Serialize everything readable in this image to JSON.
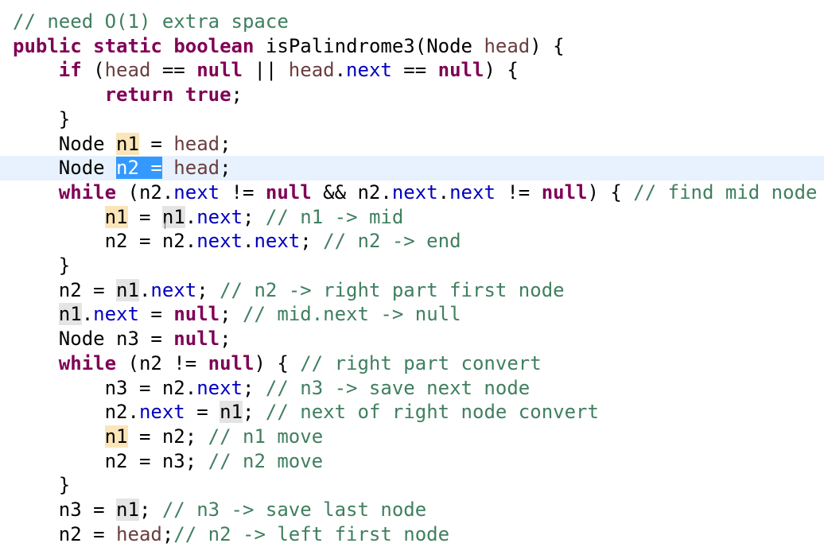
{
  "editor": {
    "language": "java",
    "colors": {
      "background": "#ffffff",
      "keyword": "#7f0055",
      "comment": "#3f7f5f",
      "field": "#0000c0",
      "parameter": "#6a3e3e",
      "current_line": "#e8f2fe",
      "occurrence_write": "#fbe5b8",
      "occurrence_read": "#e4e4e4",
      "selection": "#3399ff"
    },
    "lines": [
      {
        "tokens": [
          {
            "t": "// need O(1) extra space",
            "c": "comment"
          }
        ]
      },
      {
        "tokens": [
          {
            "t": "public",
            "c": "kw"
          },
          {
            "t": " "
          },
          {
            "t": "static",
            "c": "kw"
          },
          {
            "t": " "
          },
          {
            "t": "boolean",
            "c": "kw"
          },
          {
            "t": " isPalindrome3(Node "
          },
          {
            "t": "head",
            "c": "param"
          },
          {
            "t": ") {"
          }
        ]
      },
      {
        "tokens": [
          {
            "t": "    "
          },
          {
            "t": "if",
            "c": "kw"
          },
          {
            "t": " ("
          },
          {
            "t": "head",
            "c": "param"
          },
          {
            "t": " == "
          },
          {
            "t": "null",
            "c": "kw"
          },
          {
            "t": " || "
          },
          {
            "t": "head",
            "c": "param"
          },
          {
            "t": "."
          },
          {
            "t": "next",
            "c": "field"
          },
          {
            "t": " == "
          },
          {
            "t": "null",
            "c": "kw"
          },
          {
            "t": ") {"
          }
        ]
      },
      {
        "tokens": [
          {
            "t": "        "
          },
          {
            "t": "return",
            "c": "kw"
          },
          {
            "t": " "
          },
          {
            "t": "true",
            "c": "kw"
          },
          {
            "t": ";"
          }
        ]
      },
      {
        "tokens": [
          {
            "t": "    }"
          }
        ]
      },
      {
        "tokens": [
          {
            "t": "    Node "
          },
          {
            "t": "n1",
            "c": "hl-occ"
          },
          {
            "t": " = "
          },
          {
            "t": "head",
            "c": "param"
          },
          {
            "t": ";"
          }
        ]
      },
      {
        "current": true,
        "tokens": [
          {
            "t": "    Node "
          },
          {
            "t": "n2 =",
            "c": "hl-sel"
          },
          {
            "t": " "
          },
          {
            "t": "head",
            "c": "param"
          },
          {
            "t": ";"
          }
        ]
      },
      {
        "tokens": [
          {
            "t": "    "
          },
          {
            "t": "while",
            "c": "kw"
          },
          {
            "t": " (n2."
          },
          {
            "t": "next",
            "c": "field"
          },
          {
            "t": " != "
          },
          {
            "t": "null",
            "c": "kw"
          },
          {
            "t": " && n2."
          },
          {
            "t": "next",
            "c": "field"
          },
          {
            "t": "."
          },
          {
            "t": "next",
            "c": "field"
          },
          {
            "t": " != "
          },
          {
            "t": "null",
            "c": "kw"
          },
          {
            "t": ") { "
          },
          {
            "t": "// find mid node",
            "c": "comment"
          }
        ]
      },
      {
        "tokens": [
          {
            "t": "        "
          },
          {
            "t": "n1",
            "c": "hl-occ"
          },
          {
            "t": " = "
          },
          {
            "t": "n1",
            "c": "hl-read"
          },
          {
            "t": "."
          },
          {
            "t": "next",
            "c": "field"
          },
          {
            "t": "; "
          },
          {
            "t": "// n1 -> mid",
            "c": "comment"
          }
        ]
      },
      {
        "tokens": [
          {
            "t": "        n2 = n2."
          },
          {
            "t": "next",
            "c": "field"
          },
          {
            "t": "."
          },
          {
            "t": "next",
            "c": "field"
          },
          {
            "t": "; "
          },
          {
            "t": "// n2 -> end",
            "c": "comment"
          }
        ]
      },
      {
        "tokens": [
          {
            "t": "    }"
          }
        ]
      },
      {
        "tokens": [
          {
            "t": "    n2 = "
          },
          {
            "t": "n1",
            "c": "hl-read"
          },
          {
            "t": "."
          },
          {
            "t": "next",
            "c": "field"
          },
          {
            "t": "; "
          },
          {
            "t": "// n2 -> right part first node",
            "c": "comment"
          }
        ]
      },
      {
        "tokens": [
          {
            "t": "    "
          },
          {
            "t": "n1",
            "c": "hl-read"
          },
          {
            "t": "."
          },
          {
            "t": "next",
            "c": "field"
          },
          {
            "t": " = "
          },
          {
            "t": "null",
            "c": "kw"
          },
          {
            "t": "; "
          },
          {
            "t": "// mid.next -> null",
            "c": "comment"
          }
        ]
      },
      {
        "tokens": [
          {
            "t": "    Node n3 = "
          },
          {
            "t": "null",
            "c": "kw"
          },
          {
            "t": ";"
          }
        ]
      },
      {
        "tokens": [
          {
            "t": "    "
          },
          {
            "t": "while",
            "c": "kw"
          },
          {
            "t": " (n2 != "
          },
          {
            "t": "null",
            "c": "kw"
          },
          {
            "t": ") { "
          },
          {
            "t": "// right part convert",
            "c": "comment"
          }
        ]
      },
      {
        "tokens": [
          {
            "t": "        n3 = n2."
          },
          {
            "t": "next",
            "c": "field"
          },
          {
            "t": "; "
          },
          {
            "t": "// n3 -> save next node",
            "c": "comment"
          }
        ]
      },
      {
        "tokens": [
          {
            "t": "        n2."
          },
          {
            "t": "next",
            "c": "field"
          },
          {
            "t": " = "
          },
          {
            "t": "n1",
            "c": "hl-read"
          },
          {
            "t": "; "
          },
          {
            "t": "// next of right node convert",
            "c": "comment"
          }
        ]
      },
      {
        "tokens": [
          {
            "t": "        "
          },
          {
            "t": "n1",
            "c": "hl-occ"
          },
          {
            "t": " = n2; "
          },
          {
            "t": "// n1 move",
            "c": "comment"
          }
        ]
      },
      {
        "tokens": [
          {
            "t": "        n2 = n3; "
          },
          {
            "t": "// n2 move",
            "c": "comment"
          }
        ]
      },
      {
        "tokens": [
          {
            "t": "    }"
          }
        ]
      },
      {
        "tokens": [
          {
            "t": "    n3 = "
          },
          {
            "t": "n1",
            "c": "hl-read"
          },
          {
            "t": "; "
          },
          {
            "t": "// n3 -> save last node",
            "c": "comment"
          }
        ]
      },
      {
        "tokens": [
          {
            "t": "    n2 = "
          },
          {
            "t": "head",
            "c": "param"
          },
          {
            "t": ";"
          },
          {
            "t": "// n2 -> left first node",
            "c": "comment"
          }
        ]
      }
    ]
  }
}
